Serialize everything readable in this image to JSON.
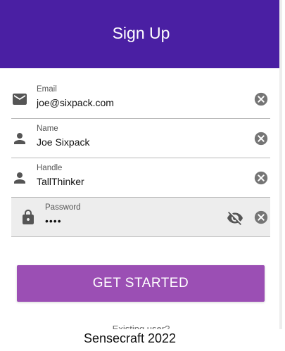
{
  "header": {
    "title": "Sign Up"
  },
  "colors": {
    "header_bg": "#4a1fa3",
    "button_bg": "#9b4fb4",
    "focused_field_bg": "#ededed"
  },
  "fields": [
    {
      "label": "Email",
      "value": "joe@sixpack.com",
      "icon": "mail-icon"
    },
    {
      "label": "Name",
      "value": "Joe Sixpack",
      "icon": "person-icon"
    },
    {
      "label": "Handle",
      "value": "TallThinker",
      "icon": "person-icon"
    },
    {
      "label": "Password",
      "value": "••••",
      "icon": "lock-icon"
    }
  ],
  "button": {
    "label": "GET STARTED"
  },
  "existing_user_text": "Existing user?",
  "footer": {
    "text": "Sensecraft 2022"
  }
}
